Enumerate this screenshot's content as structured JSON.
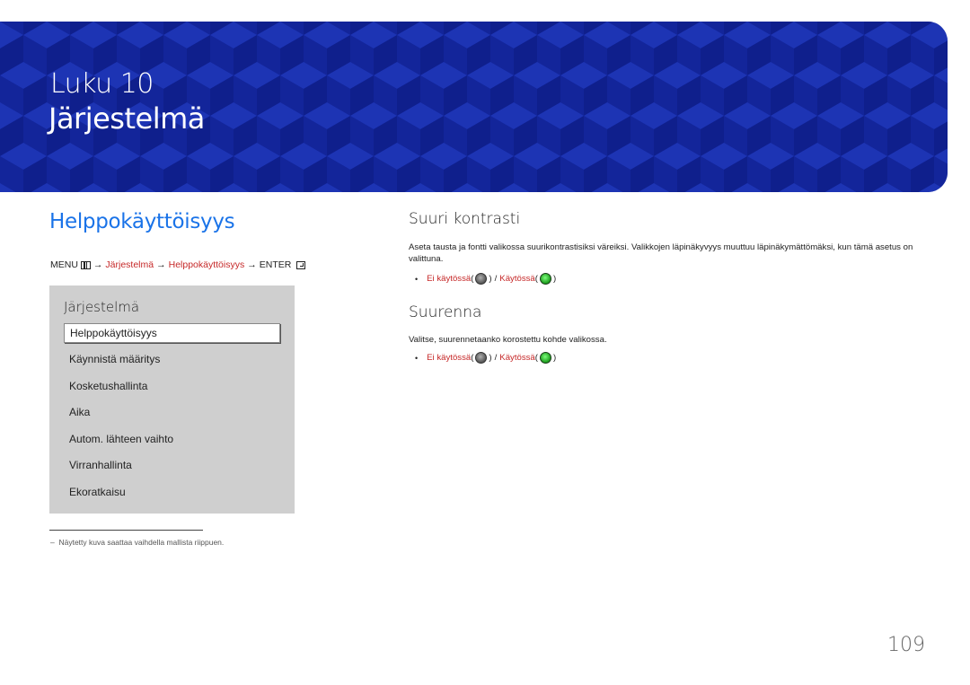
{
  "header": {
    "chapter_label": "Luku 10",
    "chapter_title": "Järjestelmä",
    "banner_color": "#1428a0"
  },
  "section": {
    "title": "Helppokäyttöisyys",
    "title_color": "#1a73e8"
  },
  "breadcrumb": {
    "menu": "MENU",
    "menu_icon": "menu-icon",
    "arrow": "→",
    "step1": "Järjestelmä",
    "step2": "Helppokäyttöisyys",
    "enter": "ENTER",
    "enter_icon": "enter-icon",
    "highlight_color": "#c62828"
  },
  "menu_panel": {
    "heading": "Järjestelmä",
    "items": [
      {
        "label": "Helppokäyttöisyys",
        "selected": true
      },
      {
        "label": "Käynnistä määritys"
      },
      {
        "label": "Kosketushallinta"
      },
      {
        "label": "Aika"
      },
      {
        "label": "Autom. lähteen vaihto"
      },
      {
        "label": "Virranhallinta"
      },
      {
        "label": "Ekoratkaisu"
      }
    ]
  },
  "footnote": "Näytetty kuva saattaa vaihdella mallista riippuen.",
  "footnote_dash": "–",
  "high_contrast": {
    "title": "Suuri kontrasti",
    "description": "Aseta tausta ja fontti valikossa suurikontrastisiksi väreiksi. Valikkojen läpinäkyvyys muuttuu läpinäkymättömäksi, kun tämä asetus on valittuna.",
    "option_off": "Ei käytössä",
    "option_on": "Käytössä"
  },
  "enlarge": {
    "title": "Suurenna",
    "description": "Valitse, suurennetaanko korostettu kohde valikossa.",
    "option_off": "Ei käytössä",
    "option_on": "Käytössä"
  },
  "glyphs": {
    "bullet": "•",
    "slash": "/",
    "open_paren": "(",
    "close_paren": ")"
  },
  "page_number": "109"
}
